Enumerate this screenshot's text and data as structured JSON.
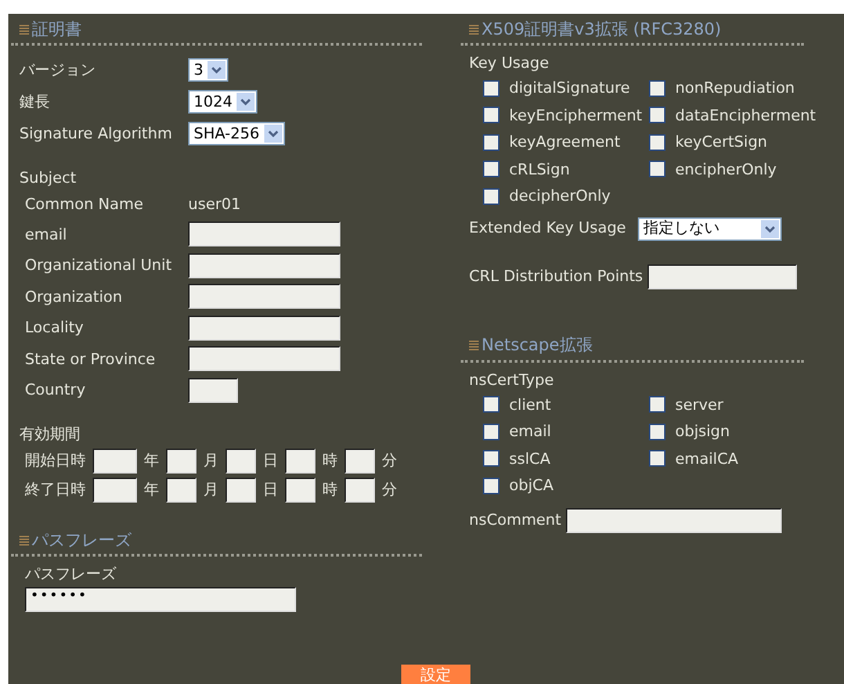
{
  "certificate": {
    "title": "証明書",
    "selects": [
      {
        "label": "バージョン",
        "value": "3"
      },
      {
        "label": "鍵長",
        "value": "1024"
      },
      {
        "label": "Signature Algorithm",
        "value": "SHA-256"
      }
    ],
    "subject": {
      "title": "Subject",
      "common_name": {
        "label": "Common Name",
        "value": "user01"
      },
      "fields": [
        {
          "label": "email",
          "kind": "wide"
        },
        {
          "label": "Organizational Unit",
          "kind": "wide"
        },
        {
          "label": "Organization",
          "kind": "wide"
        },
        {
          "label": "Locality",
          "kind": "wide"
        },
        {
          "label": "State or Province",
          "kind": "wide"
        },
        {
          "label": "Country",
          "kind": "short"
        }
      ]
    },
    "validity": {
      "title": "有効期間",
      "rows": [
        {
          "label": "開始日時",
          "units": [
            "年",
            "月",
            "日",
            "時",
            "分"
          ]
        },
        {
          "label": "終了日時",
          "units": [
            "年",
            "月",
            "日",
            "時",
            "分"
          ]
        }
      ]
    }
  },
  "passphrase": {
    "title": "パスフレーズ",
    "label": "パスフレーズ",
    "value": "••••••"
  },
  "x509": {
    "title": "X509証明書v3拡張 (RFC3280)",
    "key_usage": {
      "title": "Key Usage",
      "items": [
        {
          "label": "digitalSignature",
          "checked": false
        },
        {
          "label": "nonRepudiation",
          "checked": false
        },
        {
          "label": "keyEncipherment",
          "checked": false
        },
        {
          "label": "dataEncipherment",
          "checked": false
        },
        {
          "label": "keyAgreement",
          "checked": false
        },
        {
          "label": "keyCertSign",
          "checked": false
        },
        {
          "label": "cRLSign",
          "checked": false
        },
        {
          "label": "encipherOnly",
          "checked": false
        },
        {
          "label": "decipherOnly",
          "checked": false
        }
      ]
    },
    "extended_key_usage": {
      "label": "Extended Key Usage",
      "value": "指定しない"
    },
    "crl": {
      "label": "CRL Distribution Points"
    }
  },
  "netscape": {
    "title": "Netscape拡張",
    "cert_type": {
      "title": "nsCertType",
      "items": [
        {
          "label": "client",
          "checked": false
        },
        {
          "label": "server",
          "checked": false
        },
        {
          "label": "email",
          "checked": false
        },
        {
          "label": "objsign",
          "checked": false
        },
        {
          "label": "sslCA",
          "checked": false
        },
        {
          "label": "emailCA",
          "checked": false
        },
        {
          "label": "objCA",
          "checked": false
        }
      ]
    },
    "comment": {
      "label": "nsComment"
    }
  },
  "submit": "設定"
}
